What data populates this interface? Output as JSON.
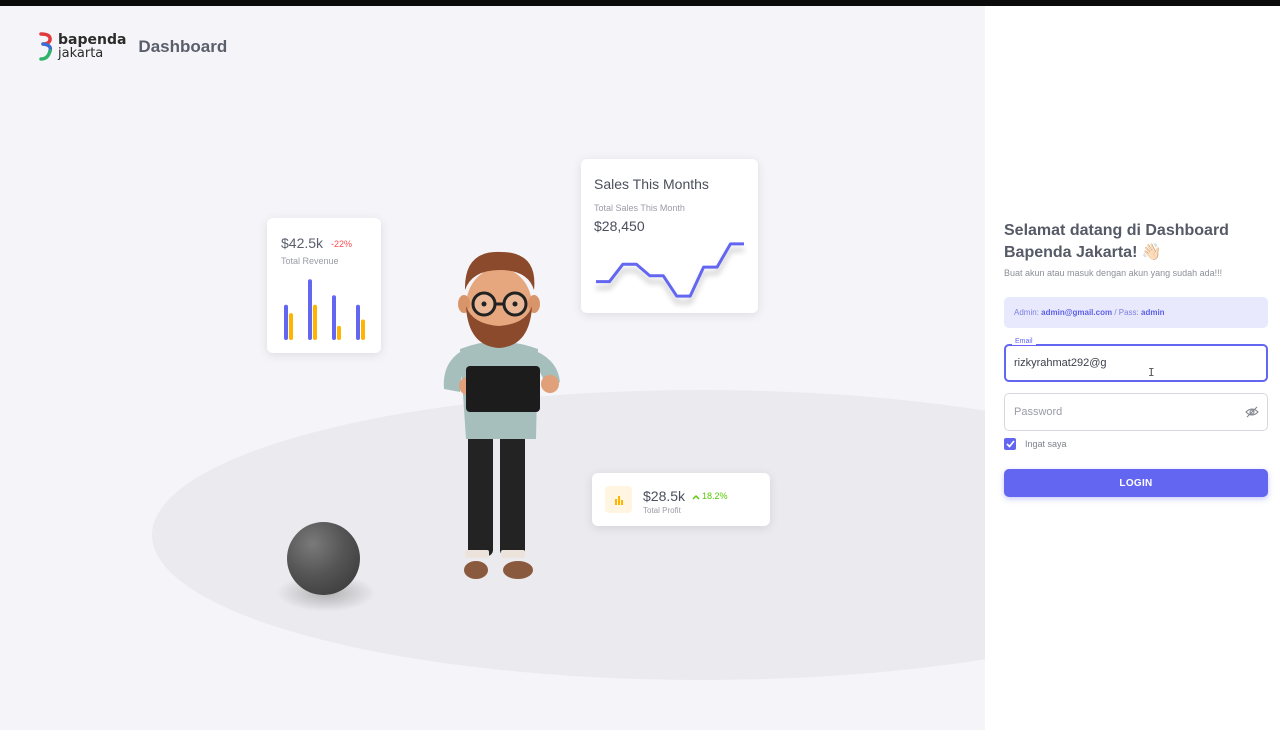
{
  "brand": {
    "line1": "bapenda",
    "line2": "jakarta",
    "page_title": "Dashboard"
  },
  "revenue_card": {
    "value": "$42.5k",
    "change": "-22%",
    "label": "Total Revenue",
    "bars": [
      {
        "primary": 0.55,
        "secondary": 0.42
      },
      {
        "primary": 0.95,
        "secondary": 0.55
      },
      {
        "primary": 0.7,
        "secondary": 0.22
      },
      {
        "primary": 0.55,
        "secondary": 0.32
      }
    ]
  },
  "sales_card": {
    "title": "Sales This Months",
    "label": "Total Sales This Month",
    "value": "$28,450",
    "trend": [
      0.3,
      0.3,
      0.6,
      0.6,
      0.4,
      0.4,
      0.05,
      0.05,
      0.55,
      0.55,
      0.95,
      0.95
    ]
  },
  "profit_card": {
    "value": "$28.5k",
    "change": "18.2%",
    "label": "Total Profit",
    "icon": "bar-chart-icon"
  },
  "login": {
    "welcome": "Selamat datang di Dashboard Bapenda Jakarta! 👋🏻",
    "subtitle": "Buat akun atau masuk dengan akun yang sudah ada!!!",
    "alert_admin_label": "Admin:",
    "alert_admin_value": "admin@gmail.com",
    "alert_sep": "/ Pass:",
    "alert_pass_value": "admin",
    "email_label": "Email",
    "email_value": "rizkyrahmat292@g",
    "password_placeholder": "Password",
    "remember_label": "Ingat saya",
    "remember_checked": true,
    "button_label": "LOGIN"
  },
  "colors": {
    "primary": "#6366f1",
    "warning": "#ffb400",
    "danger": "#ff4c51",
    "success": "#56ca00"
  }
}
